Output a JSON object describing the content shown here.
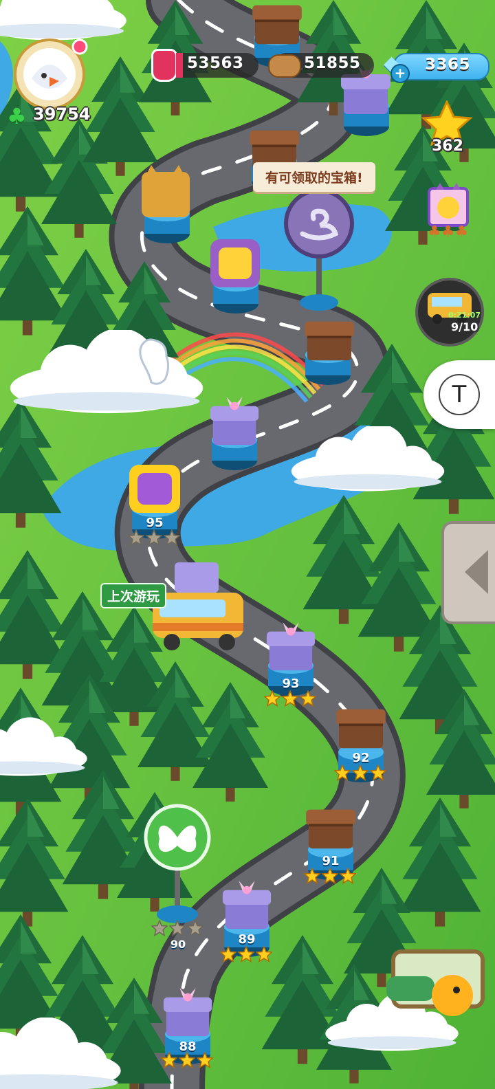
{
  "header": {
    "clover_score": "39754",
    "potion_count": "53563",
    "wood_count": "51855",
    "gem_count": "3365",
    "star_count": "362"
  },
  "side": {
    "car_timer": "0:21:07",
    "car_progress": "9/10",
    "text_tool_label": "T"
  },
  "map": {
    "chest_bubble": "有可领取的宝箱!",
    "last_played_label": "上次游玩"
  },
  "levels": [
    {
      "number": "95",
      "stars": 0
    },
    {
      "number": "93",
      "stars": 3
    },
    {
      "number": "92",
      "stars": 3
    },
    {
      "number": "91",
      "stars": 3
    },
    {
      "number": "90",
      "stars": 0
    },
    {
      "number": "89",
      "stars": 3
    },
    {
      "number": "88",
      "stars": 3
    }
  ],
  "colors": {
    "grass": "#5fbf3a",
    "road": "#5b5d63",
    "river": "#3fa9e6",
    "star_gold": "#ffcf1f",
    "star_empty": "#a8a08c"
  }
}
